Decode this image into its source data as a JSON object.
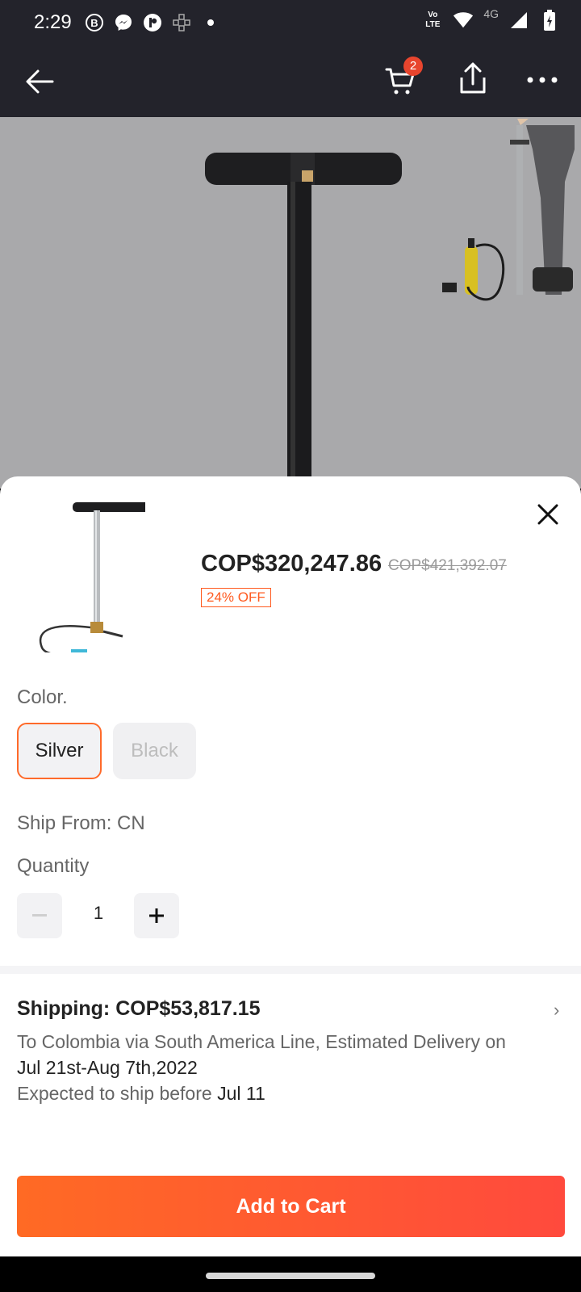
{
  "status_bar": {
    "time": "2:29",
    "lte_label": "Vo LTE",
    "network_label": "4G"
  },
  "header": {
    "cart_count": "2"
  },
  "product": {
    "price_current": "COP$320,247.86",
    "price_original": "COP$421,392.07",
    "discount": "24% OFF"
  },
  "options": {
    "color_label": "Color.",
    "colors": [
      "Silver",
      "Black"
    ],
    "selected_color": "Silver",
    "ship_from": "Ship From: CN",
    "quantity_label": "Quantity",
    "quantity_value": "1"
  },
  "shipping": {
    "title": "Shipping: COP$53,817.15",
    "line1": "To Colombia via South America Line, Estimated Delivery on",
    "dates": "Jul 21st-Aug 7th,2022",
    "expected_prefix": "Expected to ship before",
    "expected_date": "Jul 11"
  },
  "actions": {
    "add_to_cart": "Add to Cart"
  },
  "colors": {
    "accent": "#ff5a1f",
    "header_bg": "#23232b",
    "badge": "#e8452e"
  },
  "icons": [
    "back-arrow-icon",
    "cart-icon",
    "share-icon",
    "more-icon",
    "close-icon",
    "minus-icon",
    "plus-icon",
    "chevron-right-icon"
  ]
}
